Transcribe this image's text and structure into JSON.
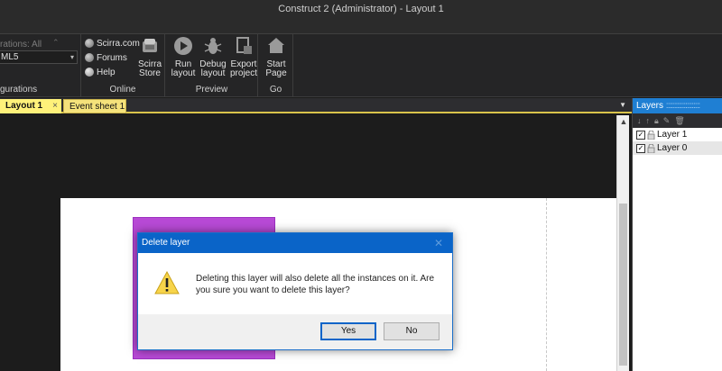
{
  "window": {
    "title": "Construct 2 (Administrator) - Layout 1"
  },
  "ribbon": {
    "configurations": {
      "label": "rations: All",
      "selected": "ML5",
      "group_label": "gurations"
    },
    "online": {
      "links": [
        "Scirra.com",
        "Forums",
        "Help"
      ],
      "store_label": "Scirra\nStore",
      "group_label": "Online"
    },
    "preview": {
      "buttons": [
        "Run\nlayout",
        "Debug\nlayout",
        "Export\nproject"
      ],
      "group_label": "Preview"
    },
    "go": {
      "buttons": [
        "Start\nPage"
      ],
      "group_label": "Go"
    }
  },
  "tabs": [
    {
      "label": "Layout 1",
      "close": "×"
    },
    {
      "label": "Event sheet 1"
    }
  ],
  "layers_panel": {
    "title": "Layers",
    "layers": [
      {
        "name": "Layer 1",
        "checked": true
      },
      {
        "name": "Layer 0",
        "checked": true,
        "selected": true
      }
    ]
  },
  "dialog": {
    "title": "Delete layer",
    "message": "Deleting this layer will also delete all the instances on it.  Are you sure you want to delete this layer?",
    "yes_label": "Yes",
    "no_label": "No"
  },
  "colors": {
    "accent_blue": "#0a64c8",
    "tab_yellow": "#fff17a",
    "sprite_purple": "#b84ad6"
  }
}
